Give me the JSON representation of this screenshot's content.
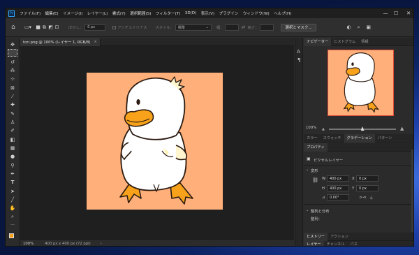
{
  "menu": {
    "items": [
      "ファイル(F)",
      "編集(E)",
      "イメージ(I)",
      "レイヤー(L)",
      "書式(Y)",
      "選択範囲(S)",
      "フィルター(T)",
      "3D(D)",
      "表示(V)",
      "プラグイン",
      "ウィンドウ(W)",
      "ヘルプ(H)"
    ],
    "logo": "Ps"
  },
  "window_controls": {
    "minimize": "—",
    "maximize": "☐",
    "close": "✕"
  },
  "options_bar": {
    "feather_label": "ぼかし：",
    "feather_value": "0 px",
    "antialias_label": "アンチエイリアス",
    "style_label": "スタイル：",
    "style_value": "標準",
    "width_label": "幅：",
    "height_label": "高さ：",
    "select_mask_button": "選択とマスク..."
  },
  "document": {
    "tab_title": "tori.png @ 100% (レイヤー 1, RGB/8)",
    "tab_close": "×"
  },
  "status": {
    "zoom": "100%",
    "doc_info": "400 px x 400 px (72 ppi)",
    "arrow": "›"
  },
  "navigator": {
    "tabs": [
      "ナビゲーター",
      "ヒストグラム",
      "情報"
    ],
    "zoom": "100%",
    "zoom_level": 0.5
  },
  "color_tabs": [
    "カラー",
    "スウォッチ",
    "グラデーション",
    "パターン"
  ],
  "properties": {
    "tab": "プロパティ",
    "layer_type": "ピクセルレイヤー",
    "transform_title": "変形",
    "w_label": "W",
    "w_value": "400 px",
    "x_label": "X",
    "x_value": "0 px",
    "h_label": "H",
    "h_value": "400 px",
    "y_label": "Y",
    "y_value": "0 px",
    "angle_value": "0.00°",
    "align_title": "整列と分布",
    "align_label": "整列："
  },
  "history_tabs": [
    "ヒストリー",
    "アクション"
  ],
  "layer_tabs": [
    "レイヤー",
    "チャンネル",
    "パス"
  ],
  "colors": {
    "canvas_bg": "#ffb07a",
    "accent": "#31a8ff",
    "beak": "#f7a21a",
    "foreground": "#f7a21a"
  }
}
